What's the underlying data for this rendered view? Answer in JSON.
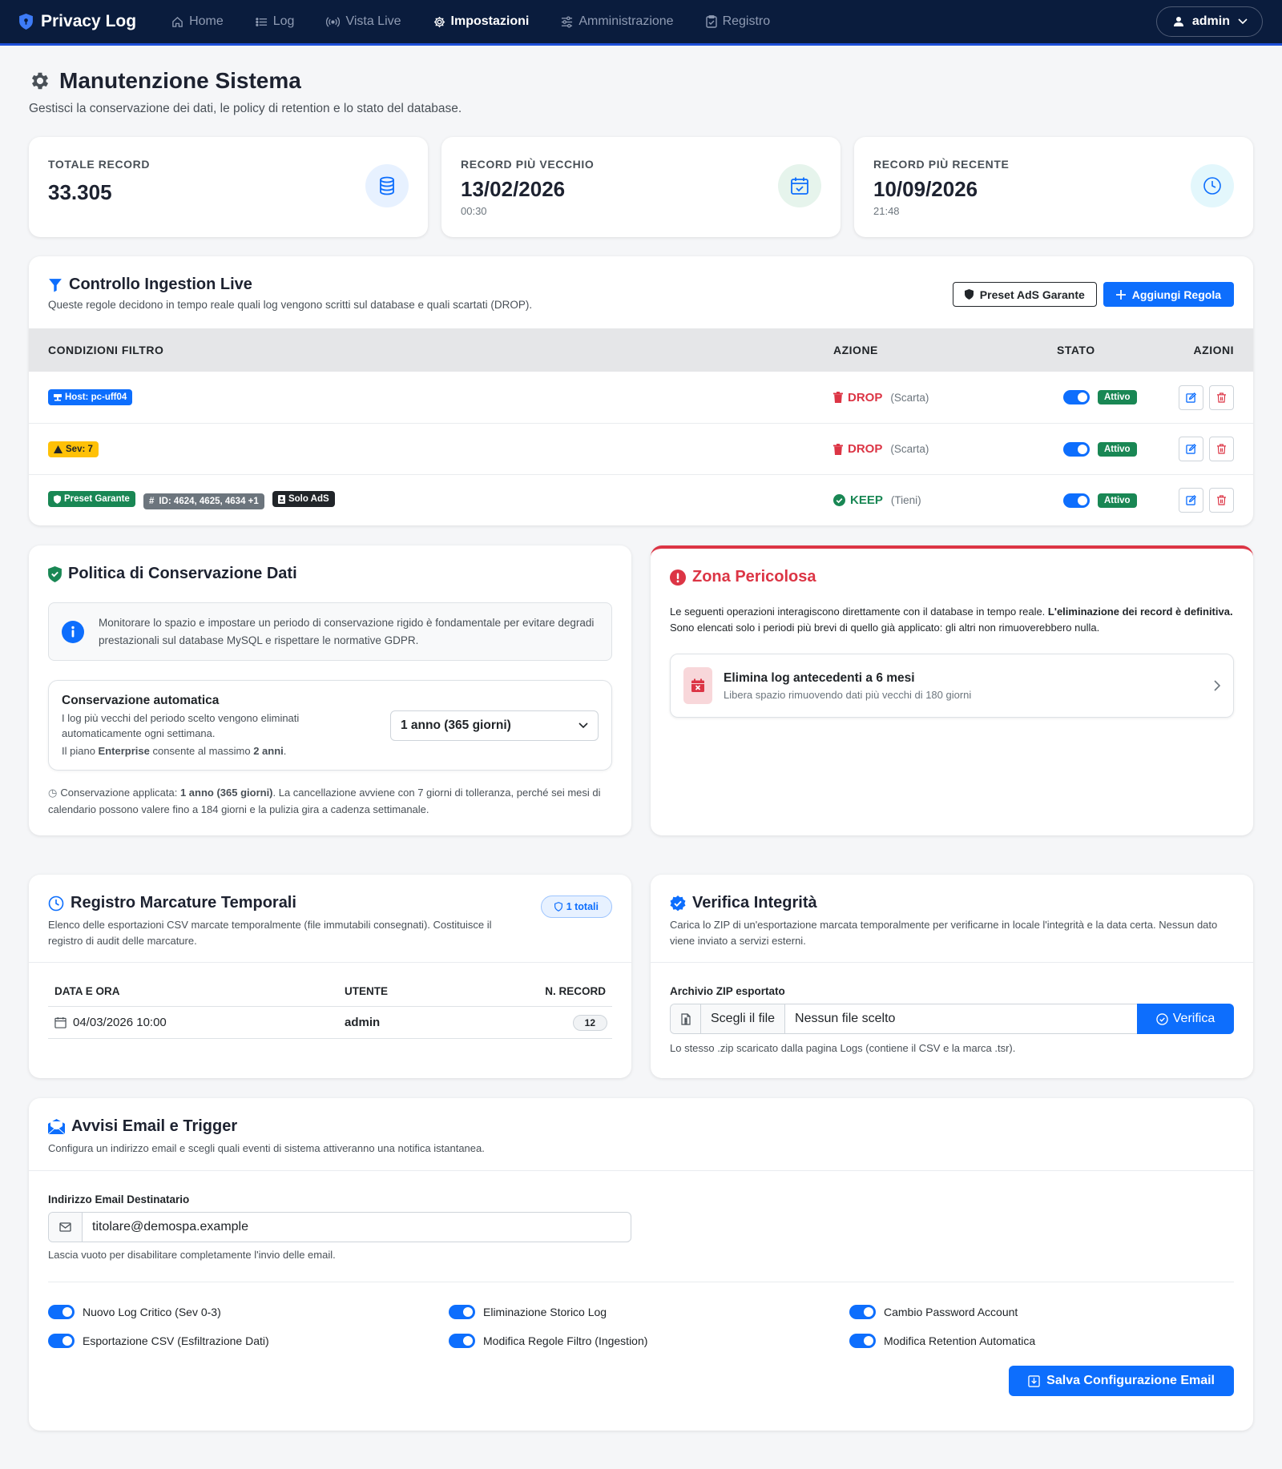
{
  "nav": {
    "brand": "Privacy Log",
    "items": [
      {
        "label": "Home",
        "icon": "home-icon"
      },
      {
        "label": "Log",
        "icon": "list-icon"
      },
      {
        "label": "Vista Live",
        "icon": "broadcast-icon"
      },
      {
        "label": "Impostazioni",
        "icon": "gear-icon"
      },
      {
        "label": "Amministrazione",
        "icon": "sliders-icon"
      },
      {
        "label": "Registro",
        "icon": "clipboard-icon"
      }
    ],
    "active": "Impostazioni",
    "user": "admin"
  },
  "page": {
    "title": "Manutenzione Sistema",
    "subtitle": "Gestisci la conservazione dei dati, le policy di retention e lo stato del database."
  },
  "stats": [
    {
      "label": "TOTALE RECORD",
      "value": "33.305",
      "sub": "",
      "icon": "database-icon",
      "color": "#0d6efd"
    },
    {
      "label": "RECORD PIÙ VECCHIO",
      "value": "13/02/2026",
      "sub": "00:30",
      "icon": "calendar-check-icon",
      "color": "#198754"
    },
    {
      "label": "RECORD PIÙ RECENTE",
      "value": "10/09/2026",
      "sub": "21:48",
      "icon": "clock-icon",
      "color": "#0dcaf0"
    }
  ],
  "ingestion": {
    "title": "Controllo Ingestion Live",
    "desc": "Queste regole decidono in tempo reale quali log vengono scritti sul database e quali scartati (DROP).",
    "preset_btn": "Preset AdS Garante",
    "add_btn": "Aggiungi Regola",
    "columns": [
      "CONDIZIONI FILTRO",
      "AZIONE",
      "STATO",
      "AZIONI"
    ],
    "rules": [
      {
        "tags": [
          {
            "text": "Host: pc-uff04",
            "color": "#0d6efd",
            "fg": "#fff",
            "icon": "host-icon"
          }
        ],
        "action": "DROP",
        "note": "(Scarta)",
        "state": "Attivo"
      },
      {
        "tags": [
          {
            "text": "Sev: 7",
            "color": "#ffc107",
            "fg": "#212529",
            "icon": "warning-icon"
          }
        ],
        "action": "DROP",
        "note": "(Scarta)",
        "state": "Attivo"
      },
      {
        "tags": [
          {
            "text": "Preset Garante",
            "color": "#198754",
            "fg": "#fff",
            "icon": "shield-icon"
          },
          {
            "text": "ID: 4624, 4625, 4634 +1",
            "color": "#6c757d",
            "fg": "#fff",
            "icon": "hash-icon"
          },
          {
            "text": "Solo AdS",
            "color": "#212529",
            "fg": "#fff",
            "icon": "badge-icon"
          }
        ],
        "action": "KEEP",
        "note": "(Tieni)",
        "state": "Attivo"
      }
    ]
  },
  "retention": {
    "title": "Politica di Conservazione Dati",
    "info": "Monitorare lo spazio e impostare un periodo di conservazione rigido è fondamentale per evitare degradi prestazionali sul database MySQL e rispettare le normative GDPR.",
    "auto_title": "Conservazione automatica",
    "auto_desc": "I log più vecchi del periodo scelto vengono eliminati automaticamente ogni settimana.",
    "plan_prefix": "Il piano ",
    "plan_name": "Enterprise",
    "plan_mid": " consente al massimo ",
    "plan_max": "2 anni",
    "plan_suffix": ".",
    "selected": "1 anno (365 giorni)",
    "applied_prefix": "Conservazione applicata: ",
    "applied_value": "1 anno (365 giorni)",
    "applied_suffix": ". La cancellazione avviene con 7 giorni di tolleranza, perché sei mesi di calendario possono valere fino a 184 giorni e la pulizia gira a cadenza settimanale."
  },
  "danger": {
    "title": "Zona Pericolosa",
    "desc_a": "Le seguenti operazioni interagiscono direttamente con il database in tempo reale. ",
    "desc_b": "L'eliminazione dei record è definitiva.",
    "desc_c": " Sono elencati solo i periodi più brevi di quello già applicato: gli altri non rimuoverebbero nulla.",
    "item_title": "Elimina log antecedenti a 6 mesi",
    "item_desc": "Libera spazio rimuovendo dati più vecchi di 180 giorni"
  },
  "timestamps": {
    "title": "Registro Marcature Temporali",
    "badge": "1 totali",
    "desc": "Elenco delle esportazioni CSV marcate temporalmente (file immutabili consegnati). Costituisce il registro di audit delle marcature.",
    "columns": [
      "DATA E ORA",
      "UTENTE",
      "N. RECORD"
    ],
    "rows": [
      {
        "date": "04/03/2026 10:00",
        "user": "admin",
        "count": "12"
      }
    ]
  },
  "integrity": {
    "title": "Verifica Integrità",
    "desc": "Carica lo ZIP di un'esportazione marcata temporalmente per verificarne in locale l'integrità e la data certa. Nessun dato viene inviato a servizi esterni.",
    "label": "Archivio ZIP esportato",
    "choose": "Scegli il file",
    "nofile": "Nessun file scelto",
    "verify": "Verifica",
    "help": "Lo stesso .zip scaricato dalla pagina Logs (contiene il CSV e la marca .tsr)."
  },
  "email": {
    "title": "Avvisi Email e Trigger",
    "desc": "Configura un indirizzo email e scegli quali eventi di sistema attiveranno una notifica istantanea.",
    "label": "Indirizzo Email Destinatario",
    "value": "titolare@demospa.example",
    "help": "Lascia vuoto per disabilitare completamente l'invio delle email.",
    "toggles": [
      "Nuovo Log Critico (Sev 0-3)",
      "Eliminazione Storico Log",
      "Cambio Password Account",
      "Esportazione CSV (Esfiltrazione Dati)",
      "Modifica Regole Filtro (Ingestion)",
      "Modifica Retention Automatica"
    ],
    "save": "Salva Configurazione Email"
  }
}
